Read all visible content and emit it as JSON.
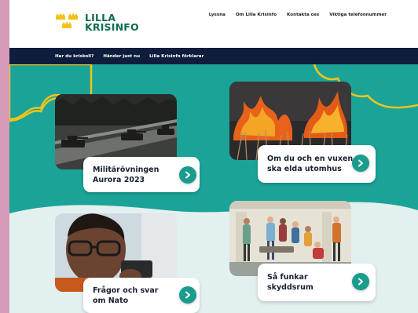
{
  "logo": {
    "line1": "LILLA",
    "line2": "KRISINFO",
    "icon": "three-crowns-icon"
  },
  "top_nav": [
    "Lyssna",
    "Om Lilla Krisinfo",
    "Kontakta oss",
    "Viktiga telefonnummer"
  ],
  "main_nav": [
    "Har du kriskoll?",
    "Händer just nu",
    "Lilla Krisinfo förklarar"
  ],
  "cards": [
    {
      "title": "Militärövningen Aurora 2023",
      "icon": "chevron-right-icon"
    },
    {
      "title": "Om du och en vuxen ska elda utomhus",
      "icon": "chevron-right-icon"
    },
    {
      "title": "Frågor och svar om Nato",
      "icon": "chevron-right-icon"
    },
    {
      "title": "Så funkar skyddsrum",
      "icon": "chevron-right-icon"
    }
  ],
  "colors": {
    "brand_green": "#0f6b50",
    "nav_dark": "#0f1d3c",
    "hero_teal": "#1ba398",
    "cloud_yellow": "#f0c419",
    "crown_yellow": "#f2c21b",
    "arrow_teal": "#1a9c8e"
  }
}
